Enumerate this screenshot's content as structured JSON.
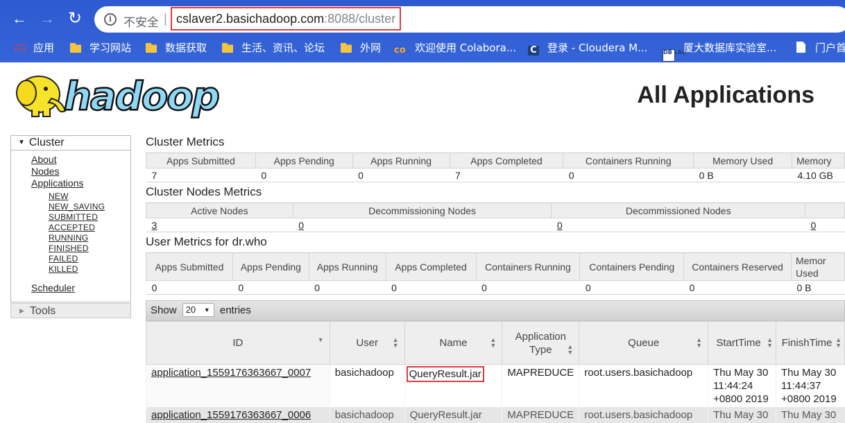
{
  "browser": {
    "insecure_label": "不安全",
    "separator": "|",
    "url_host": "cslaver2.basichadoop.com",
    "url_rest": ":8088/cluster",
    "bookmarks": [
      {
        "label": "应用",
        "icon": "apps-icon"
      },
      {
        "label": "学习网站",
        "icon": "folder-icon"
      },
      {
        "label": "数据获取",
        "icon": "folder-icon"
      },
      {
        "label": "生活、资讯、论坛",
        "icon": "folder-icon"
      },
      {
        "label": "外网",
        "icon": "folder-icon"
      },
      {
        "label": "欢迎使用 Colabora...",
        "icon": "colab-icon"
      },
      {
        "label": "登录 - Cloudera M...",
        "icon": "cloudera-icon"
      },
      {
        "label": "厦大数据库实验室...",
        "icon": "dblab-icon"
      },
      {
        "label": "门户首",
        "icon": "doc-icon"
      }
    ],
    "colab_icon_text": "co",
    "cloudera_icon_text": "C",
    "dblab_icon_text": "DB LAB"
  },
  "page": {
    "title": "All Applications",
    "logo_text": "hadoop"
  },
  "nav": {
    "cluster_label": "Cluster",
    "links": [
      "About",
      "Nodes",
      "Applications"
    ],
    "app_states": [
      "NEW",
      "NEW_SAVING",
      "SUBMITTED",
      "ACCEPTED",
      "RUNNING",
      "FINISHED",
      "FAILED",
      "KILLED"
    ],
    "scheduler_label": "Scheduler",
    "tools_label": "Tools"
  },
  "cluster_metrics": {
    "title": "Cluster Metrics",
    "headers": [
      "Apps Submitted",
      "Apps Pending",
      "Apps Running",
      "Apps Completed",
      "Containers Running",
      "Memory Used",
      "Memory"
    ],
    "values": [
      "7",
      "0",
      "0",
      "7",
      "0",
      "0 B",
      "4.10 GB"
    ]
  },
  "node_metrics": {
    "title": "Cluster Nodes Metrics",
    "headers": [
      "Active Nodes",
      "Decommissioning Nodes",
      "Decommissioned Nodes",
      ""
    ],
    "values": [
      "3",
      "0",
      "0",
      "0"
    ]
  },
  "user_metrics": {
    "title": "User Metrics for dr.who",
    "headers": [
      "Apps Submitted",
      "Apps Pending",
      "Apps Running",
      "Apps Completed",
      "Containers Running",
      "Containers Pending",
      "Containers Reserved",
      "Memor Used"
    ],
    "values": [
      "0",
      "0",
      "0",
      "0",
      "0",
      "0",
      "0",
      "0 B"
    ]
  },
  "entries": {
    "show_label": "Show",
    "page_size": "20",
    "entries_label": "entries"
  },
  "apps_table": {
    "headers": [
      "ID",
      "User",
      "Name",
      "Application Type",
      "Queue",
      "StartTime",
      "FinishTime"
    ],
    "rows": [
      {
        "id": "application_1559176363667_0007",
        "user": "basichadoop",
        "name": "QueryResult.jar",
        "type": "MAPREDUCE",
        "queue": "root.users.basichadoop",
        "start": "Thu May 30 11:44:24 +0800 2019",
        "finish": "Thu May 30 11:44:37 +0800 2019"
      },
      {
        "id": "application_1559176363667_0006",
        "user": "basichadoop",
        "name": "QueryResult.jar",
        "type": "MAPREDUCE",
        "queue": "root.users.basichadoop",
        "start": "Thu May 30",
        "finish": "Thu May 30"
      }
    ]
  }
}
